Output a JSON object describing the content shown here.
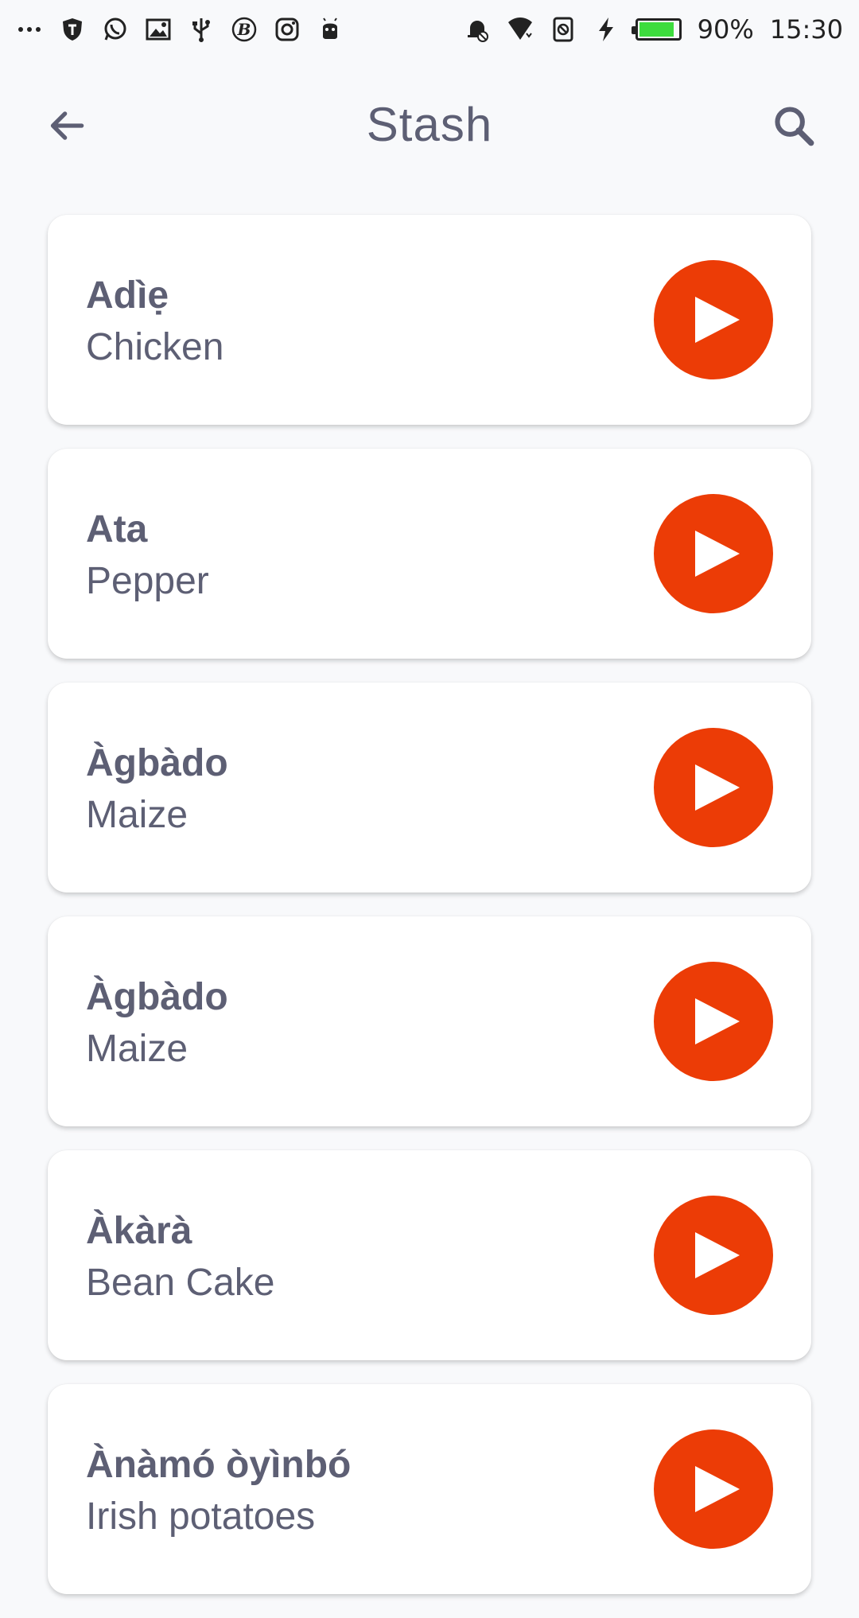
{
  "status_bar": {
    "left_icons": [
      "more-dots-icon",
      "shield-icon",
      "whatsapp-icon",
      "image-icon",
      "usb-icon",
      "b-circle-icon",
      "instagram-icon",
      "android-icon"
    ],
    "right_icons": [
      "alarm-off-icon",
      "wifi-icon",
      "blocked-icon",
      "charging-bolt-icon"
    ],
    "battery_level": 0.9,
    "battery_text": "90%",
    "time": "15:30",
    "battery_color": "#3ddc3d"
  },
  "app_bar": {
    "title": "Stash",
    "back_icon": "arrow-left-icon",
    "search_icon": "search-icon"
  },
  "accent_color": "#ec3c06",
  "items": [
    {
      "word": "Adìẹ",
      "translation": "Chicken"
    },
    {
      "word": "Ata",
      "translation": "Pepper"
    },
    {
      "word": "Àgbàdo",
      "translation": "Maize"
    },
    {
      "word": "Àgbàdo",
      "translation": "Maize"
    },
    {
      "word": "Àkàrà",
      "translation": "Bean Cake"
    },
    {
      "word": "Ànàmó òyìnbó",
      "translation": "Irish potatoes"
    }
  ]
}
